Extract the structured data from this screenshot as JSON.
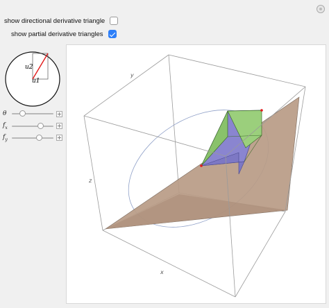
{
  "controls": {
    "directional_label": "show directional derivative triangle",
    "directional_checked": false,
    "partial_label": "show partial derivative triangles",
    "partial_checked": true
  },
  "disk": {
    "u1_label": "u1",
    "u2_label": "u2"
  },
  "sliders": [
    {
      "label": "θ",
      "sub": "",
      "value": 0.25
    },
    {
      "label": "f",
      "sub": "x",
      "value": 0.68
    },
    {
      "label": "f",
      "sub": "y",
      "value": 0.65
    }
  ],
  "plot": {
    "x_label": "x",
    "y_label": "y",
    "z_label": "z"
  },
  "colors": {
    "plane": "#b99b85",
    "green_face": "#89c26b",
    "purple_face": "#8a85d0",
    "accent": "#2d7ff9",
    "red": "#e21a1a"
  }
}
